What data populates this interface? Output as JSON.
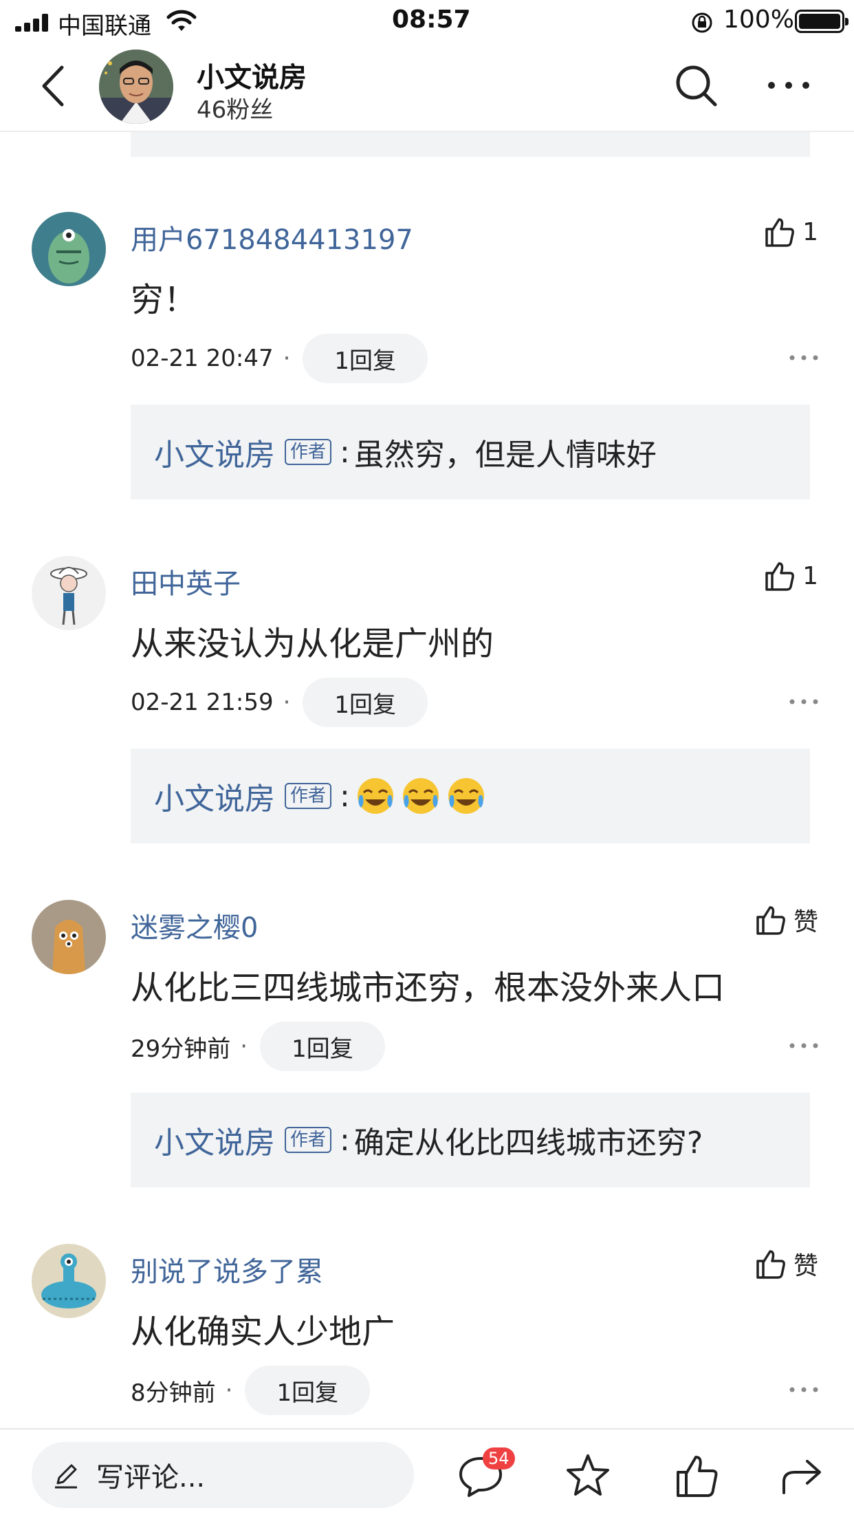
{
  "status_bar": {
    "carrier": "中国联通",
    "time": "08:57",
    "battery": "100%"
  },
  "header": {
    "author_name": "小文说房",
    "fans": "46粉丝"
  },
  "comments": [
    {
      "user": "用户6718484413197",
      "likes": "1",
      "text": "穷！",
      "time": "02-21 20:47",
      "reply_count": "1回复",
      "reply": {
        "name": "小文说房",
        "badge": "作者",
        "colon": ":",
        "text": "虽然穷，但是人情味好"
      }
    },
    {
      "user": "田中英子",
      "likes": "1",
      "text": "从来没认为从化是广州的",
      "time": "02-21 21:59",
      "reply_count": "1回复",
      "reply": {
        "name": "小文说房",
        "badge": "作者",
        "colon": ":",
        "emojis": [
          "crying-laughing",
          "crying-laughing",
          "crying-laughing"
        ]
      }
    },
    {
      "user": "迷雾之樱0",
      "likes": "赞",
      "text": "从化比三四线城市还穷，根本没外来人口",
      "time": "29分钟前",
      "reply_count": "1回复",
      "reply": {
        "name": "小文说房",
        "badge": "作者",
        "colon": ":",
        "text": "确定从化比四线城市还穷?"
      }
    },
    {
      "user": "别说了说多了累",
      "likes": "赞",
      "text": "从化确实人少地广",
      "time": "8分钟前",
      "reply_count": "1回复"
    }
  ],
  "separator": "·",
  "bottom_bar": {
    "input_placeholder": "写评论...",
    "comment_badge": "54"
  },
  "colors": {
    "link_blue": "#406599",
    "reply_bg": "#f2f3f5",
    "badge_red": "#f04142"
  }
}
